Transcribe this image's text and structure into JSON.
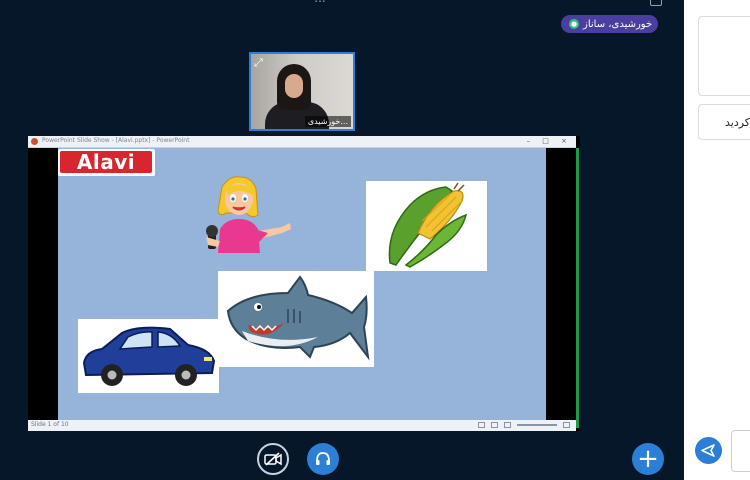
{
  "header": {
    "title": "..."
  },
  "speaker": {
    "name": "خورشیدی، ساناز"
  },
  "webcam": {
    "name": "خورشیدی..."
  },
  "presentation": {
    "window_title": "PowerPoint Slide Show - [Alavi.pptx] - PowerPoint",
    "status_text": "Slide 1 of 10",
    "logo_text": "Alavi",
    "window_controls": "–  □  ×"
  },
  "controls": {
    "plus_label": "+"
  },
  "side_panel": {
    "box2_text": "کردید"
  },
  "colors": {
    "background": "#06172a",
    "accent": "#2d7fd6",
    "badge": "#4a3fa0",
    "slide_bg": "#96b3d9"
  },
  "icons": [
    "microphone-icon",
    "expand-icon",
    "camera-off-icon",
    "headset-icon",
    "plus-icon",
    "send-icon"
  ]
}
